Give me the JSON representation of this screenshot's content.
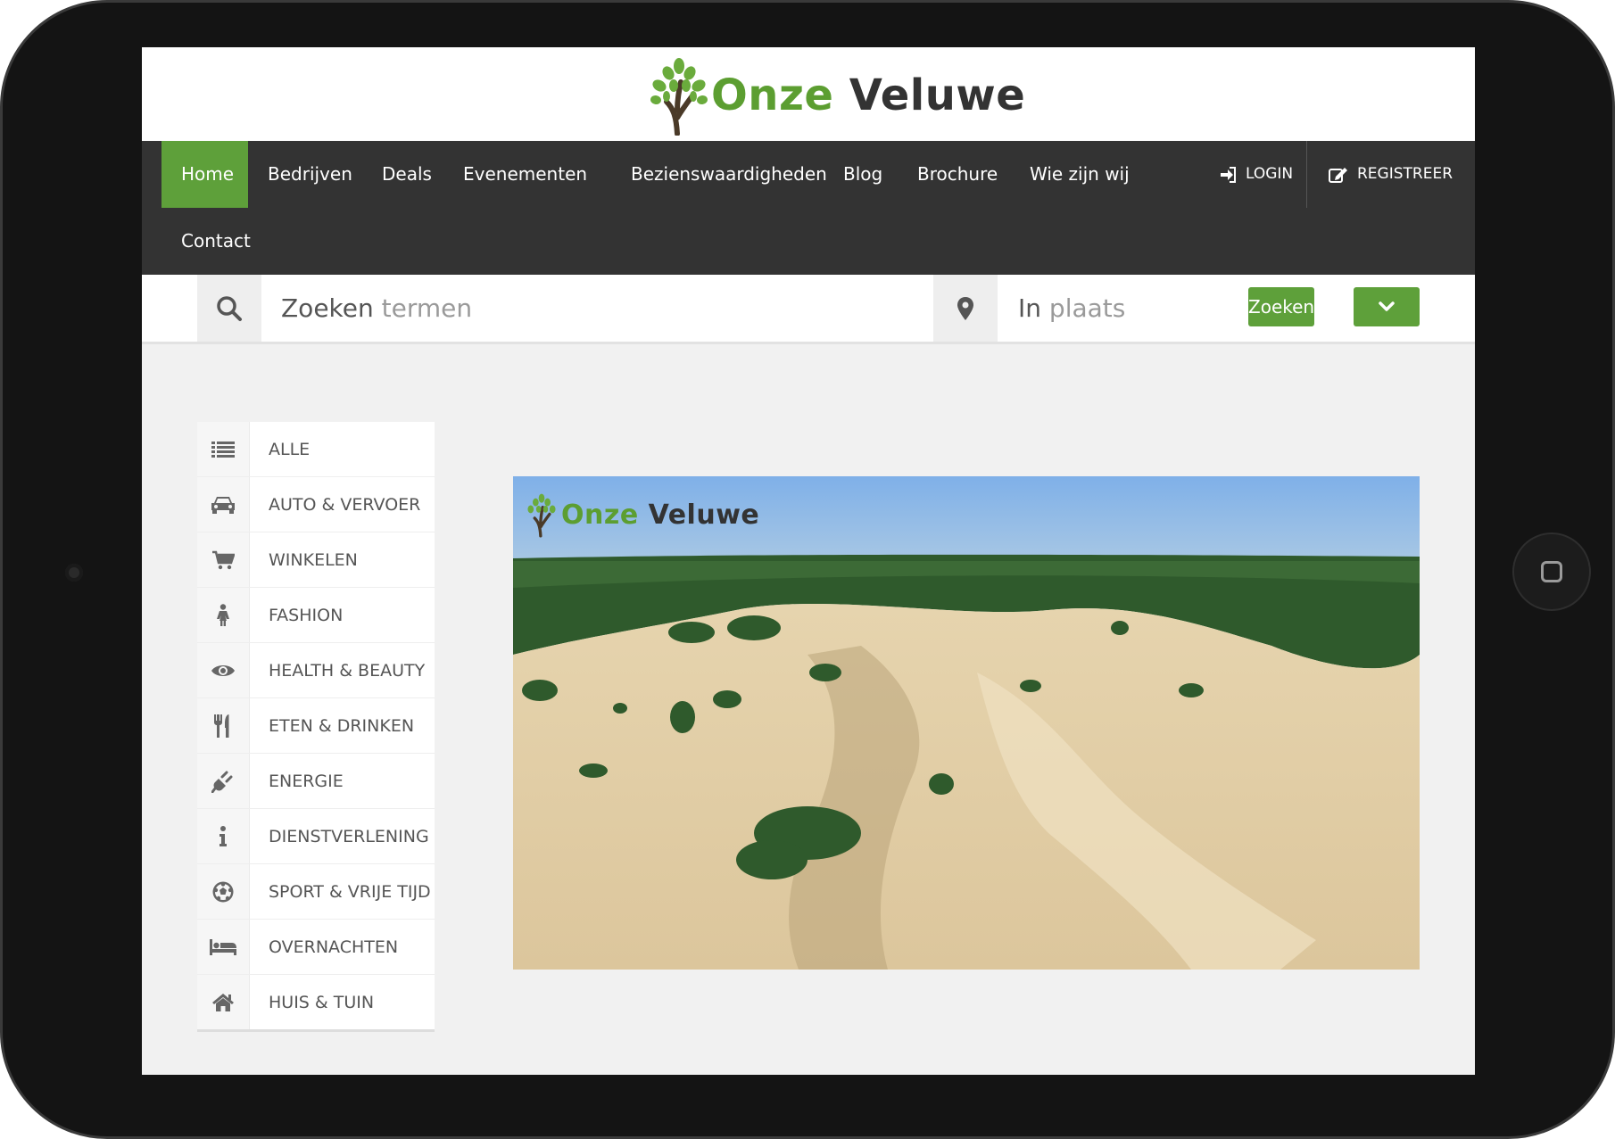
{
  "brand": {
    "name_part1": "Onze",
    "name_part2": "Veluwe"
  },
  "nav": {
    "items": [
      {
        "label": "Home",
        "active": true
      },
      {
        "label": "Bedrijven"
      },
      {
        "label": "Deals"
      },
      {
        "label": "Evenementen"
      },
      {
        "label": "Bezienswaardigheden"
      },
      {
        "label": "Blog"
      },
      {
        "label": "Brochure"
      },
      {
        "label": "Wie zijn wij"
      },
      {
        "label": "Contact"
      }
    ],
    "login_label": "LOGIN",
    "register_label": "REGISTREER"
  },
  "search": {
    "term_label": "Zoeken",
    "term_placeholder": "termen",
    "place_label": "In",
    "place_placeholder": "plaats",
    "submit_label": "Zoeken"
  },
  "categories": [
    {
      "label": "ALLE",
      "icon": "list-icon"
    },
    {
      "label": "AUTO & VERVOER",
      "icon": "car-icon"
    },
    {
      "label": "WINKELEN",
      "icon": "cart-icon"
    },
    {
      "label": "FASHION",
      "icon": "female-icon"
    },
    {
      "label": "HEALTH & BEAUTY",
      "icon": "eye-icon"
    },
    {
      "label": "ETEN & DRINKEN",
      "icon": "cutlery-icon"
    },
    {
      "label": "ENERGIE",
      "icon": "plug-icon"
    },
    {
      "label": "DIENSTVERLENING",
      "icon": "info-icon"
    },
    {
      "label": "SPORT & VRIJE TIJD",
      "icon": "soccer-ball-icon"
    },
    {
      "label": "OVERNACHTEN",
      "icon": "bed-icon"
    },
    {
      "label": "HUIS & TUIN",
      "icon": "home-icon"
    }
  ],
  "hero": {
    "logo_part1": "Onze",
    "logo_part2": "Veluwe"
  },
  "colors": {
    "accent": "#5ea03a",
    "nav_bg": "#333333",
    "page_bg": "#f1f1f1"
  }
}
